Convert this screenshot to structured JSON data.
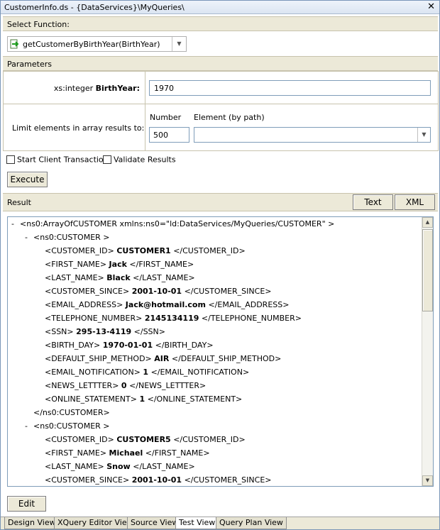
{
  "window": {
    "title": "CustomerInfo.ds - {DataServices}\\MyQueries\\",
    "close_glyph": "✕"
  },
  "select_function": {
    "header": "Select Function:",
    "selected": "getCustomerByBirthYear(BirthYear)",
    "icon": "function-arrow-icon"
  },
  "parameters": {
    "header": "Parameters",
    "birth_type": "xs:integer",
    "birth_name": "BirthYear:",
    "birth_value": "1970",
    "limit_label": "Limit elements in array results to:",
    "number_label": "Number",
    "element_label": "Element (by path)",
    "number_value": "500",
    "element_value": ""
  },
  "options": {
    "start_tx": "Start Client Transaction",
    "validate": "Validate Results",
    "execute": "Execute"
  },
  "result": {
    "label": "Result",
    "text_button": "Text",
    "xml_button": "XML",
    "lines": [
      {
        "indent": 0,
        "toggle": "-",
        "open": "<ns0:ArrayOfCUSTOMER xmlns:ns0=\"ld:DataServices/MyQueries/CUSTOMER\" >",
        "value": "",
        "close": ""
      },
      {
        "indent": 1,
        "toggle": "-",
        "open": "<ns0:CUSTOMER >",
        "value": "",
        "close": ""
      },
      {
        "indent": 2,
        "toggle": "",
        "open": "<CUSTOMER_ID>",
        "value": "CUSTOMER1",
        "close": "</CUSTOMER_ID>"
      },
      {
        "indent": 2,
        "toggle": "",
        "open": "<FIRST_NAME>",
        "value": "Jack",
        "close": "</FIRST_NAME>"
      },
      {
        "indent": 2,
        "toggle": "",
        "open": "<LAST_NAME>",
        "value": "Black",
        "close": "</LAST_NAME>"
      },
      {
        "indent": 2,
        "toggle": "",
        "open": "<CUSTOMER_SINCE>",
        "value": "2001-10-01",
        "close": "</CUSTOMER_SINCE>"
      },
      {
        "indent": 2,
        "toggle": "",
        "open": "<EMAIL_ADDRESS>",
        "value": "Jack@hotmail.com",
        "close": "</EMAIL_ADDRESS>"
      },
      {
        "indent": 2,
        "toggle": "",
        "open": "<TELEPHONE_NUMBER>",
        "value": "2145134119",
        "close": "</TELEPHONE_NUMBER>"
      },
      {
        "indent": 2,
        "toggle": "",
        "open": "<SSN>",
        "value": "295-13-4119",
        "close": "</SSN>"
      },
      {
        "indent": 2,
        "toggle": "",
        "open": "<BIRTH_DAY>",
        "value": "1970-01-01",
        "close": "</BIRTH_DAY>"
      },
      {
        "indent": 2,
        "toggle": "",
        "open": "<DEFAULT_SHIP_METHOD>",
        "value": "AIR",
        "close": "</DEFAULT_SHIP_METHOD>"
      },
      {
        "indent": 2,
        "toggle": "",
        "open": "<EMAIL_NOTIFICATION>",
        "value": "1",
        "close": "</EMAIL_NOTIFICATION>"
      },
      {
        "indent": 2,
        "toggle": "",
        "open": "<NEWS_LETTTER>",
        "value": "0",
        "close": "</NEWS_LETTTER>"
      },
      {
        "indent": 2,
        "toggle": "",
        "open": "<ONLINE_STATEMENT>",
        "value": "1",
        "close": "</ONLINE_STATEMENT>"
      },
      {
        "indent": 1,
        "toggle": "",
        "open": "</ns0:CUSTOMER>",
        "value": "",
        "close": ""
      },
      {
        "indent": 1,
        "toggle": "-",
        "open": "<ns0:CUSTOMER >",
        "value": "",
        "close": ""
      },
      {
        "indent": 2,
        "toggle": "",
        "open": "<CUSTOMER_ID>",
        "value": "CUSTOMER5",
        "close": "</CUSTOMER_ID>"
      },
      {
        "indent": 2,
        "toggle": "",
        "open": "<FIRST_NAME>",
        "value": "Michael",
        "close": "</FIRST_NAME>"
      },
      {
        "indent": 2,
        "toggle": "",
        "open": "<LAST_NAME>",
        "value": "Snow",
        "close": "</LAST_NAME>"
      },
      {
        "indent": 2,
        "toggle": "",
        "open": "<CUSTOMER_SINCE>",
        "value": "2001-10-01",
        "close": "</CUSTOMER_SINCE>"
      }
    ]
  },
  "edit_button": "Edit",
  "tabs": [
    {
      "label": "Design View",
      "active": false
    },
    {
      "label": "XQuery Editor View",
      "active": false
    },
    {
      "label": "Source View",
      "active": false
    },
    {
      "label": "Test View",
      "active": true
    },
    {
      "label": "Query Plan View",
      "active": false
    }
  ]
}
